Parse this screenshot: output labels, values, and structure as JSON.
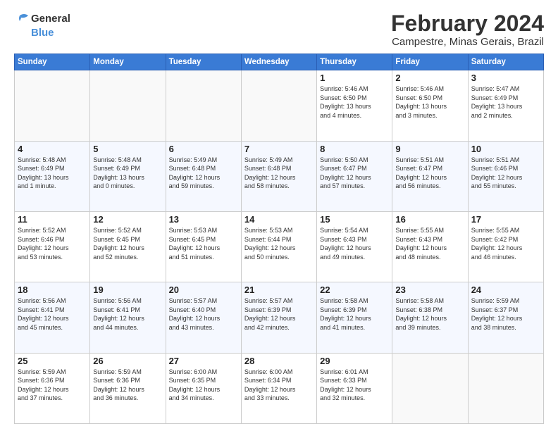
{
  "header": {
    "logo_line1": "General",
    "logo_line2": "Blue",
    "title": "February 2024",
    "subtitle": "Campestre, Minas Gerais, Brazil"
  },
  "weekdays": [
    "Sunday",
    "Monday",
    "Tuesday",
    "Wednesday",
    "Thursday",
    "Friday",
    "Saturday"
  ],
  "rows": [
    [
      {
        "day": "",
        "info": ""
      },
      {
        "day": "",
        "info": ""
      },
      {
        "day": "",
        "info": ""
      },
      {
        "day": "",
        "info": ""
      },
      {
        "day": "1",
        "info": "Sunrise: 5:46 AM\nSunset: 6:50 PM\nDaylight: 13 hours\nand 4 minutes."
      },
      {
        "day": "2",
        "info": "Sunrise: 5:46 AM\nSunset: 6:50 PM\nDaylight: 13 hours\nand 3 minutes."
      },
      {
        "day": "3",
        "info": "Sunrise: 5:47 AM\nSunset: 6:49 PM\nDaylight: 13 hours\nand 2 minutes."
      }
    ],
    [
      {
        "day": "4",
        "info": "Sunrise: 5:48 AM\nSunset: 6:49 PM\nDaylight: 13 hours\nand 1 minute."
      },
      {
        "day": "5",
        "info": "Sunrise: 5:48 AM\nSunset: 6:49 PM\nDaylight: 13 hours\nand 0 minutes."
      },
      {
        "day": "6",
        "info": "Sunrise: 5:49 AM\nSunset: 6:48 PM\nDaylight: 12 hours\nand 59 minutes."
      },
      {
        "day": "7",
        "info": "Sunrise: 5:49 AM\nSunset: 6:48 PM\nDaylight: 12 hours\nand 58 minutes."
      },
      {
        "day": "8",
        "info": "Sunrise: 5:50 AM\nSunset: 6:47 PM\nDaylight: 12 hours\nand 57 minutes."
      },
      {
        "day": "9",
        "info": "Sunrise: 5:51 AM\nSunset: 6:47 PM\nDaylight: 12 hours\nand 56 minutes."
      },
      {
        "day": "10",
        "info": "Sunrise: 5:51 AM\nSunset: 6:46 PM\nDaylight: 12 hours\nand 55 minutes."
      }
    ],
    [
      {
        "day": "11",
        "info": "Sunrise: 5:52 AM\nSunset: 6:46 PM\nDaylight: 12 hours\nand 53 minutes."
      },
      {
        "day": "12",
        "info": "Sunrise: 5:52 AM\nSunset: 6:45 PM\nDaylight: 12 hours\nand 52 minutes."
      },
      {
        "day": "13",
        "info": "Sunrise: 5:53 AM\nSunset: 6:45 PM\nDaylight: 12 hours\nand 51 minutes."
      },
      {
        "day": "14",
        "info": "Sunrise: 5:53 AM\nSunset: 6:44 PM\nDaylight: 12 hours\nand 50 minutes."
      },
      {
        "day": "15",
        "info": "Sunrise: 5:54 AM\nSunset: 6:43 PM\nDaylight: 12 hours\nand 49 minutes."
      },
      {
        "day": "16",
        "info": "Sunrise: 5:55 AM\nSunset: 6:43 PM\nDaylight: 12 hours\nand 48 minutes."
      },
      {
        "day": "17",
        "info": "Sunrise: 5:55 AM\nSunset: 6:42 PM\nDaylight: 12 hours\nand 46 minutes."
      }
    ],
    [
      {
        "day": "18",
        "info": "Sunrise: 5:56 AM\nSunset: 6:41 PM\nDaylight: 12 hours\nand 45 minutes."
      },
      {
        "day": "19",
        "info": "Sunrise: 5:56 AM\nSunset: 6:41 PM\nDaylight: 12 hours\nand 44 minutes."
      },
      {
        "day": "20",
        "info": "Sunrise: 5:57 AM\nSunset: 6:40 PM\nDaylight: 12 hours\nand 43 minutes."
      },
      {
        "day": "21",
        "info": "Sunrise: 5:57 AM\nSunset: 6:39 PM\nDaylight: 12 hours\nand 42 minutes."
      },
      {
        "day": "22",
        "info": "Sunrise: 5:58 AM\nSunset: 6:39 PM\nDaylight: 12 hours\nand 41 minutes."
      },
      {
        "day": "23",
        "info": "Sunrise: 5:58 AM\nSunset: 6:38 PM\nDaylight: 12 hours\nand 39 minutes."
      },
      {
        "day": "24",
        "info": "Sunrise: 5:59 AM\nSunset: 6:37 PM\nDaylight: 12 hours\nand 38 minutes."
      }
    ],
    [
      {
        "day": "25",
        "info": "Sunrise: 5:59 AM\nSunset: 6:36 PM\nDaylight: 12 hours\nand 37 minutes."
      },
      {
        "day": "26",
        "info": "Sunrise: 5:59 AM\nSunset: 6:36 PM\nDaylight: 12 hours\nand 36 minutes."
      },
      {
        "day": "27",
        "info": "Sunrise: 6:00 AM\nSunset: 6:35 PM\nDaylight: 12 hours\nand 34 minutes."
      },
      {
        "day": "28",
        "info": "Sunrise: 6:00 AM\nSunset: 6:34 PM\nDaylight: 12 hours\nand 33 minutes."
      },
      {
        "day": "29",
        "info": "Sunrise: 6:01 AM\nSunset: 6:33 PM\nDaylight: 12 hours\nand 32 minutes."
      },
      {
        "day": "",
        "info": ""
      },
      {
        "day": "",
        "info": ""
      }
    ]
  ]
}
